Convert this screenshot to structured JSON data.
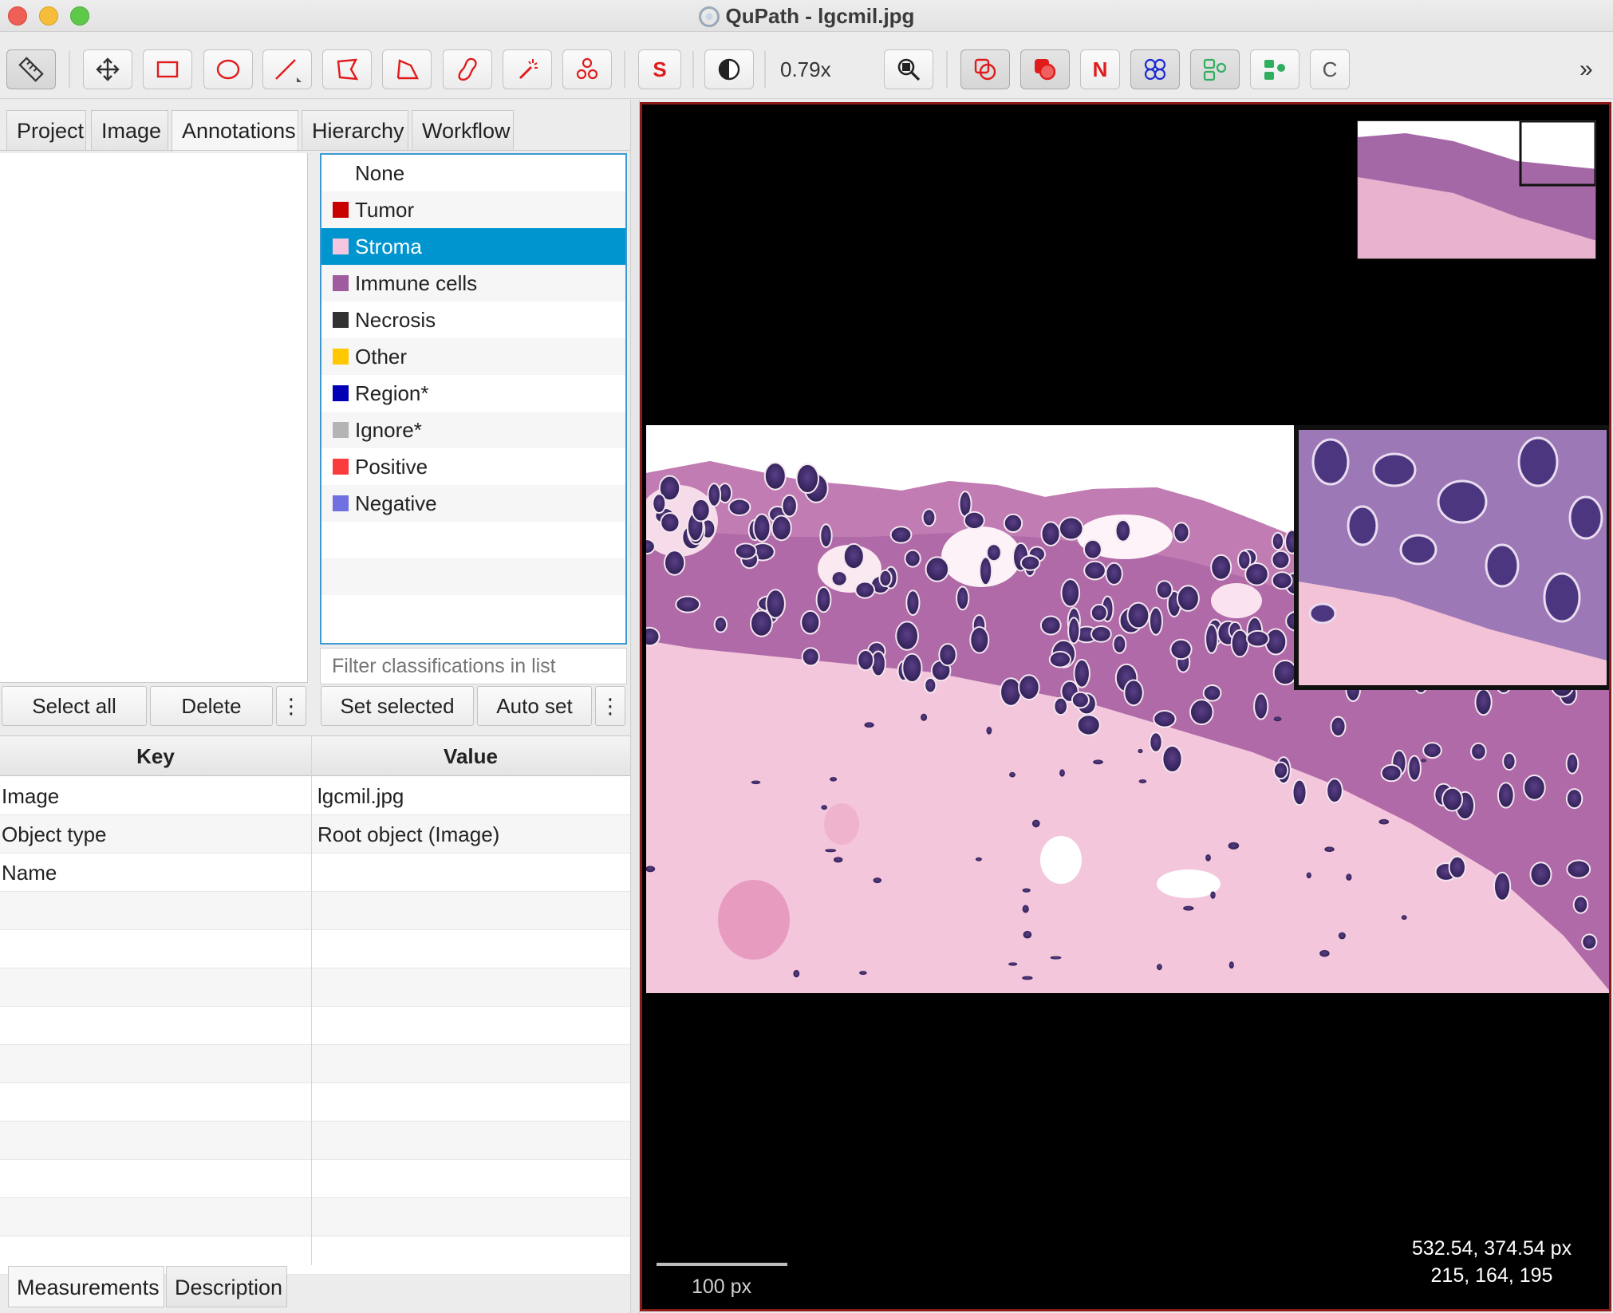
{
  "window": {
    "title": "QuPath - lgcmil.jpg"
  },
  "toolbar": {
    "zoom_level": "0.79x",
    "tools": [
      {
        "icon": "ruler-icon"
      },
      {
        "icon": "move-icon"
      },
      {
        "icon": "rectangle-icon"
      },
      {
        "icon": "ellipse-icon"
      },
      {
        "icon": "line-icon"
      },
      {
        "icon": "polygon-icon"
      },
      {
        "icon": "polyline-icon"
      },
      {
        "icon": "brush-icon"
      },
      {
        "icon": "wand-icon"
      },
      {
        "icon": "points-icon"
      },
      {
        "icon": "selection-mode-icon",
        "label": "S"
      },
      {
        "icon": "brightness-contrast-icon"
      },
      {
        "icon": "zoom-to-fit-icon"
      },
      {
        "icon": "show-annotations-icon"
      },
      {
        "icon": "fill-annotations-icon"
      },
      {
        "icon": "show-names-icon",
        "label": "N"
      },
      {
        "icon": "show-tma-grid-icon"
      },
      {
        "icon": "show-detections-icon"
      },
      {
        "icon": "fill-detections-icon"
      },
      {
        "icon": "cell-boundaries-icon",
        "label": "C"
      }
    ],
    "overflow_label": "»"
  },
  "left_tabs": [
    "Project",
    "Image",
    "Annotations",
    "Hierarchy",
    "Workflow"
  ],
  "active_left_tab": "Annotations",
  "classifications": [
    {
      "name": "None",
      "color": "#ffffff"
    },
    {
      "name": "Tumor",
      "color": "#c80000"
    },
    {
      "name": "Stroma",
      "color": "#f5c6e0"
    },
    {
      "name": "Immune cells",
      "color": "#a05aa0"
    },
    {
      "name": "Necrosis",
      "color": "#323232"
    },
    {
      "name": "Other",
      "color": "#ffc800"
    },
    {
      "name": "Region*",
      "color": "#0000b4"
    },
    {
      "name": "Ignore*",
      "color": "#b4b4b4"
    },
    {
      "name": "Positive",
      "color": "#fa3c3c"
    },
    {
      "name": "Negative",
      "color": "#7070e0"
    }
  ],
  "selected_classification": "Stroma",
  "filter": {
    "placeholder": "Filter classifications in list"
  },
  "annotation_buttons": {
    "select_all": "Select all",
    "delete": "Delete",
    "more": "⋮"
  },
  "class_buttons": {
    "set_selected": "Set selected",
    "auto_set": "Auto set",
    "more": "⋮"
  },
  "measurements": {
    "headers": {
      "key": "Key",
      "value": "Value"
    },
    "rows": [
      {
        "key": "Image",
        "value": "lgcmil.jpg"
      },
      {
        "key": "Object type",
        "value": "Root object (Image)"
      },
      {
        "key": "Name",
        "value": ""
      }
    ]
  },
  "bottom_tabs": [
    "Measurements",
    "Description"
  ],
  "viewer": {
    "scalebar_label": "100 px",
    "cursor_coords": "532.54, 374.54 px",
    "pixel_rgb": "215, 164, 195",
    "border_color": "#8b1a1a"
  }
}
